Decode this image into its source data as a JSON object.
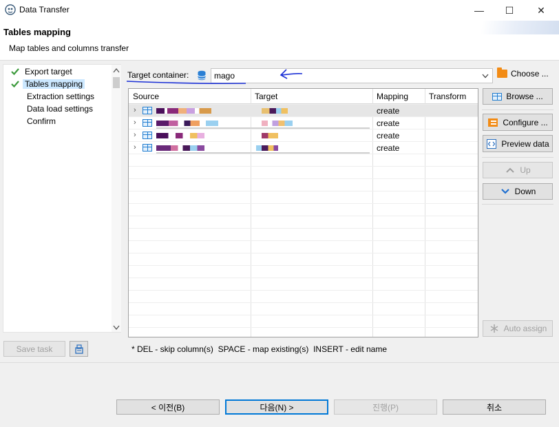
{
  "window": {
    "title": "Data Transfer",
    "controls": [
      "—",
      "☐",
      "✕"
    ]
  },
  "header": {
    "title": "Tables mapping",
    "subtitle": "Map tables and columns transfer"
  },
  "nav": {
    "items": [
      {
        "label": "Export target",
        "done": true
      },
      {
        "label": "Tables mapping",
        "done": true,
        "selected": true
      },
      {
        "label": "Extraction settings"
      },
      {
        "label": "Data load settings"
      },
      {
        "label": "Confirm"
      }
    ],
    "scroll_up": "^",
    "scroll_down": "v"
  },
  "target_container": {
    "label": "Target container:",
    "value": "mago",
    "choose_label": "Choose ..."
  },
  "table": {
    "columns": [
      "Source",
      "Target",
      "Mapping",
      "Transform"
    ],
    "rows": [
      {
        "mapping": "create"
      },
      {
        "mapping": "create"
      },
      {
        "mapping": "create"
      },
      {
        "mapping": "create"
      }
    ]
  },
  "side_buttons": {
    "browse": "Browse ...",
    "configure": "Configure ...",
    "preview": "Preview data",
    "up": "Up",
    "down": "Down",
    "auto_assign": "Auto assign"
  },
  "hint": "* DEL - skip column(s)  SPACE - map existing(s)  INSERT - edit name",
  "save_task": "Save task",
  "footer": {
    "back": "< 이전(B)",
    "next": "다음(N) >",
    "proceed": "진행(P)",
    "cancel": "취소"
  },
  "colors": {
    "accent": "#0078d7",
    "selection": "#cce8ff",
    "check": "#3c9a3c",
    "annotation": "#1a2fd6"
  }
}
